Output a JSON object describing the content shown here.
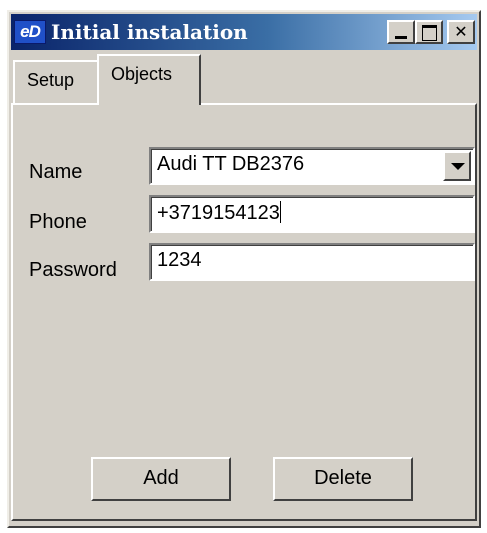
{
  "window": {
    "title": "Initial instalation",
    "icon_text": "eD",
    "icon_name": "app-icon"
  },
  "titlebar_buttons": {
    "minimize": "minimize-icon",
    "maximize": "maximize-icon",
    "close": "close-icon"
  },
  "tabs": [
    {
      "label": "Setup",
      "selected": false
    },
    {
      "label": "Objects",
      "selected": true
    }
  ],
  "form": {
    "name_label": "Name",
    "name_value": "Audi TT DB2376",
    "phone_label": "Phone",
    "phone_value": "+3719154123",
    "password_label": "Password",
    "password_value": "1234"
  },
  "buttons": {
    "add": "Add",
    "delete": "Delete"
  }
}
